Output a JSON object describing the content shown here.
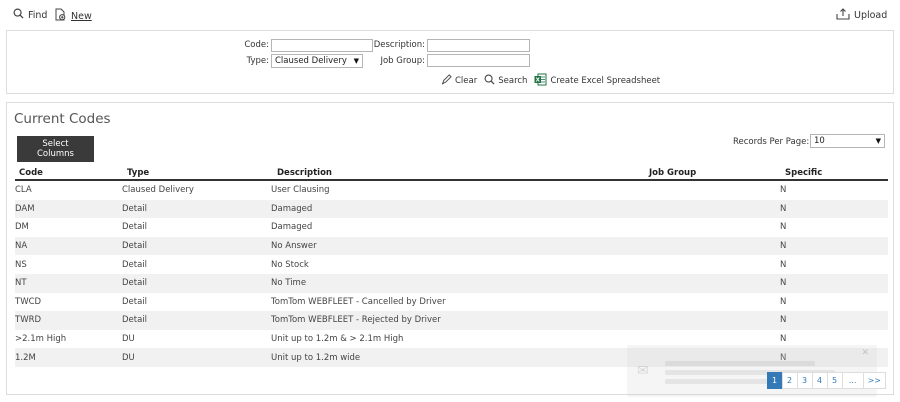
{
  "toolbar": {
    "find_label": "Find",
    "new_label": "New",
    "upload_label": "Upload"
  },
  "search": {
    "code_label": "Code:",
    "code_value": "",
    "description_label": "Description:",
    "description_value": "",
    "type_label": "Type:",
    "type_selected": "Claused Delivery",
    "job_group_label": "Job Group:",
    "job_group_value": "",
    "clear_label": "Clear",
    "search_label": "Search",
    "excel_label": "Create Excel Spreadsheet"
  },
  "codes": {
    "title": "Current Codes",
    "select_columns_label": "Select Columns",
    "records_per_page_label": "Records Per Page:",
    "records_per_page_value": "10",
    "columns": [
      "Code",
      "Type",
      "Description",
      "Job Group",
      "Specific"
    ],
    "rows": [
      {
        "code": "CLA",
        "type": "Claused Delivery",
        "description": "User Clausing",
        "job_group": "",
        "specific": "N"
      },
      {
        "code": "DAM",
        "type": "Detail",
        "description": "Damaged",
        "job_group": "",
        "specific": "N"
      },
      {
        "code": "DM",
        "type": "Detail",
        "description": "Damaged",
        "job_group": "",
        "specific": "N"
      },
      {
        "code": "NA",
        "type": "Detail",
        "description": "No Answer",
        "job_group": "",
        "specific": "N"
      },
      {
        "code": "NS",
        "type": "Detail",
        "description": "No Stock",
        "job_group": "",
        "specific": "N"
      },
      {
        "code": "NT",
        "type": "Detail",
        "description": "No Time",
        "job_group": "",
        "specific": "N"
      },
      {
        "code": "TWCD",
        "type": "Detail",
        "description": "TomTom WEBFLEET - Cancelled by Driver",
        "job_group": "",
        "specific": "N"
      },
      {
        "code": "TWRD",
        "type": "Detail",
        "description": "TomTom WEBFLEET - Rejected by Driver",
        "job_group": "",
        "specific": "N"
      },
      {
        "code": ">2.1m High",
        "type": "DU",
        "description": "Unit up to 1.2m & > 2.1m High",
        "job_group": "",
        "specific": "N"
      },
      {
        "code": "1.2M",
        "type": "DU",
        "description": "Unit up to 1.2m wide",
        "job_group": "",
        "specific": "N"
      }
    ],
    "pagination": [
      "1",
      "2",
      "3",
      "4",
      "5",
      "...",
      ">>"
    ],
    "current_page": "1"
  },
  "colors": {
    "accent": "#337ab7",
    "button_dark": "#3a3a3a",
    "row_alt": "#f1f1f1",
    "excel_green": "#217346"
  }
}
